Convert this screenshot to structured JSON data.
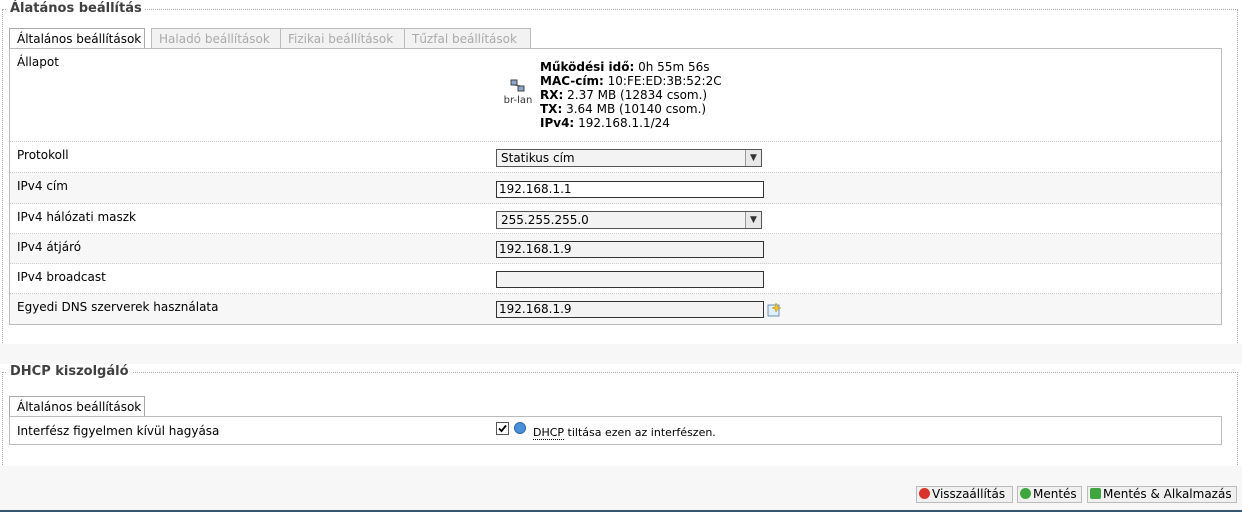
{
  "general": {
    "legend": "Álatános beállítás",
    "tabs": [
      "Általános beállítások",
      "Haladó beállítások",
      "Fizikai beállítások",
      "Tűzfal beállítások"
    ],
    "status": {
      "label": "Állapot",
      "device": "br-lan",
      "uptime_label": "Működési idő:",
      "uptime_value": "0h 55m 56s",
      "mac_label": "MAC-cím:",
      "mac_value": "10:FE:ED:3B:52:2C",
      "rx_label": "RX:",
      "rx_value": "2.37 MB (12834 csom.)",
      "tx_label": "TX:",
      "tx_value": "3.64 MB (10140 csom.)",
      "ipv4_label": "IPv4:",
      "ipv4_value": "192.168.1.1/24"
    },
    "protocol": {
      "label": "Protokoll",
      "value": "Statikus cím"
    },
    "ipv4_address": {
      "label": "IPv4 cím",
      "value": "192.168.1.1"
    },
    "netmask": {
      "label": "IPv4 hálózati maszk",
      "value": "255.255.255.0"
    },
    "gateway": {
      "label": "IPv4 átjáró",
      "value": "192.168.1.9"
    },
    "broadcast": {
      "label": "IPv4 broadcast",
      "value": ""
    },
    "dns": {
      "label": "Egyedi DNS szerverek használata",
      "value": "192.168.1.9"
    }
  },
  "dhcp": {
    "legend": "DHCP kiszolgáló",
    "tab": "Általános beállítások",
    "ignore": {
      "label": "Interfész figyelmen kívül hagyása",
      "checked": true,
      "help_abbr": "DHCP",
      "help_text": " tiltása ezen az interfészen."
    }
  },
  "buttons": {
    "reset": "Visszaállítás",
    "save": "Mentés",
    "save_apply": "Mentés & Alkalmazás"
  },
  "colors": {
    "reset_icon": "#d9342b",
    "save_icon": "#3fa63f",
    "apply_icon": "#3fa63f"
  }
}
